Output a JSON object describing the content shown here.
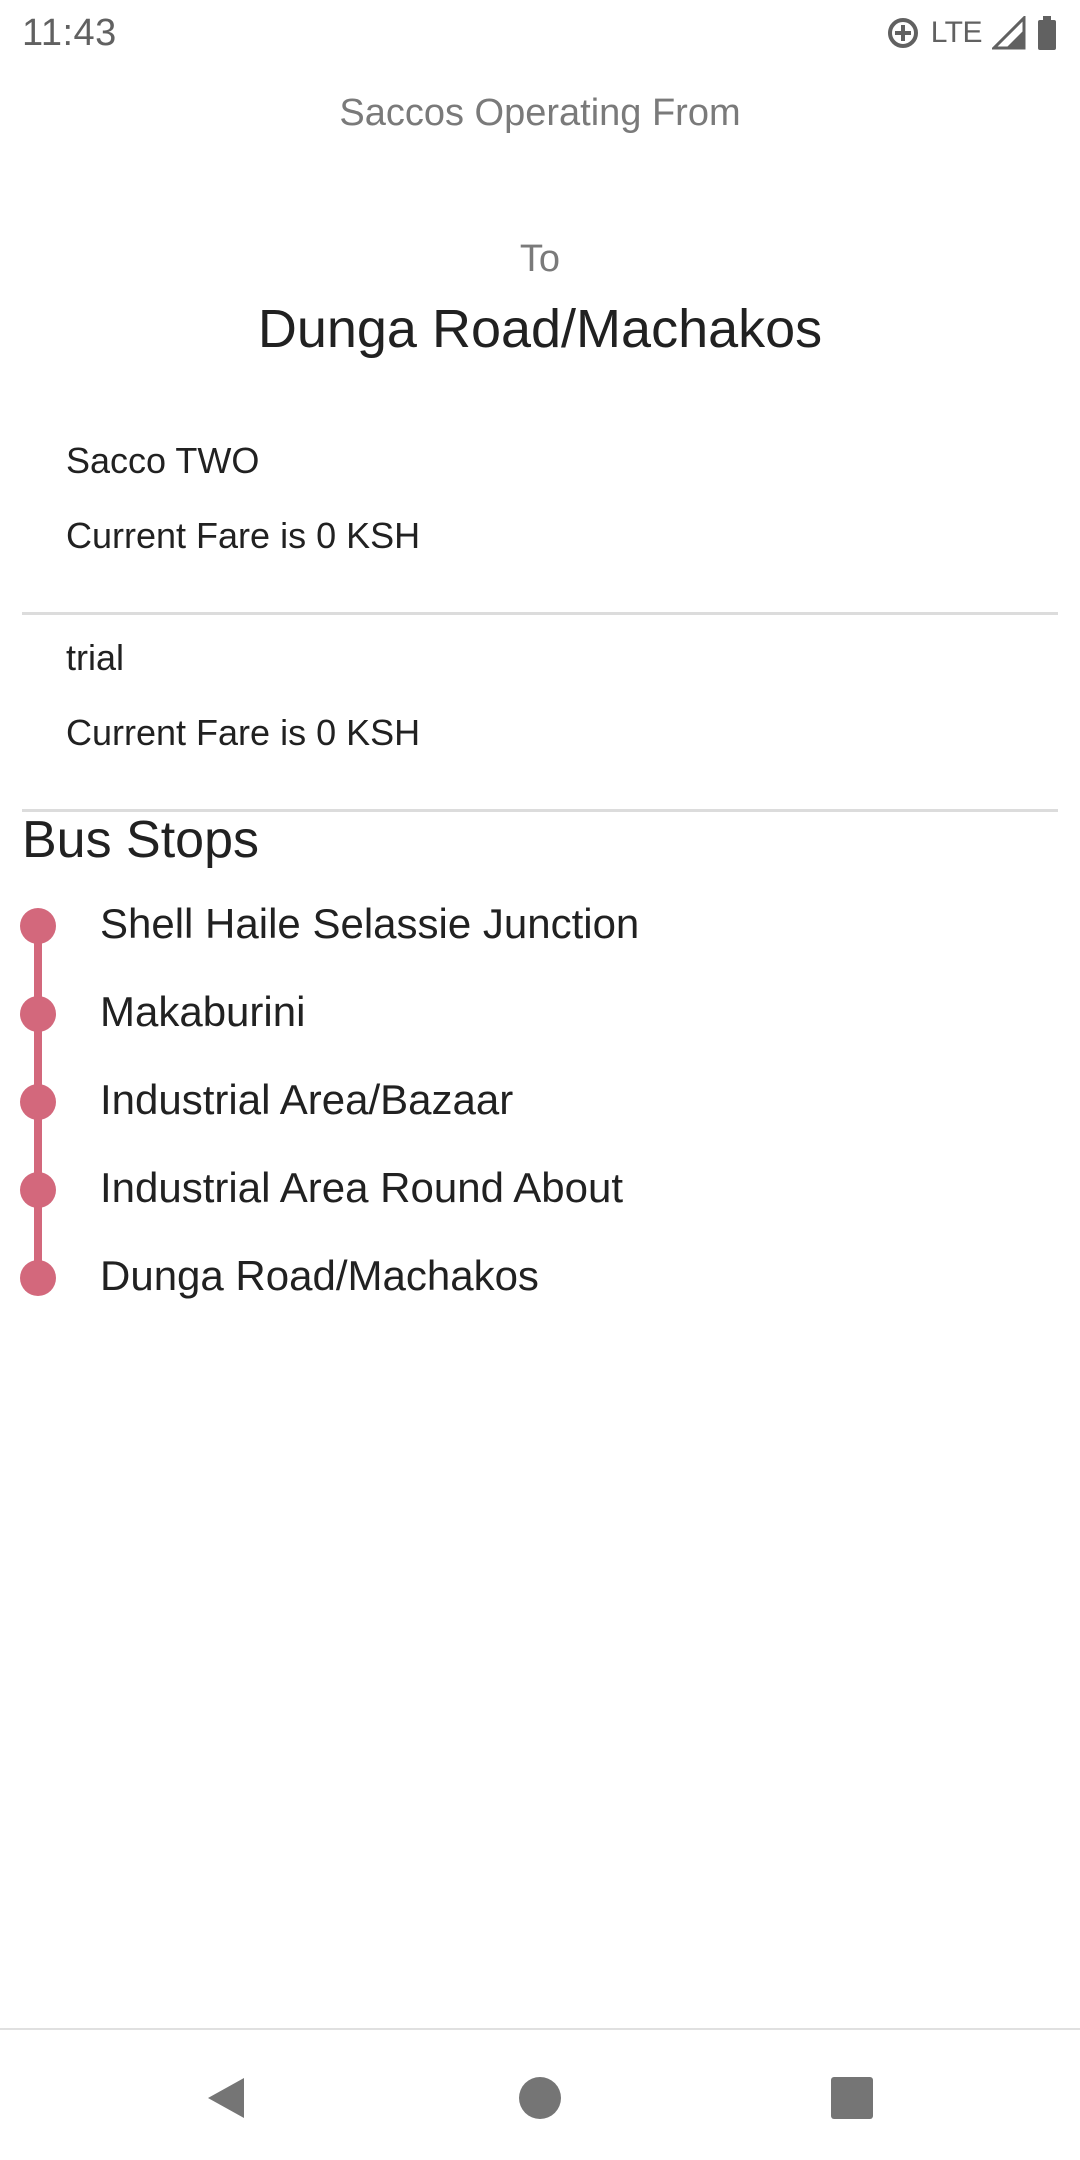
{
  "status_bar": {
    "time": "11:43",
    "network_label": "LTE",
    "icons": [
      "data-saver-icon",
      "signal-icon",
      "battery-icon"
    ]
  },
  "header": {
    "from_label": "Saccos Operating From",
    "to_label": "To",
    "destination": "Dunga Road/Machakos"
  },
  "saccos": [
    {
      "name": "Sacco TWO",
      "fare": "Current Fare is 0 KSH"
    },
    {
      "name": "trial",
      "fare": "Current Fare is 0 KSH"
    }
  ],
  "bus_stops": {
    "heading": "Bus Stops",
    "accent_color": "#d3687c",
    "stops": [
      "Shell Haile Selassie Junction",
      "Makaburini",
      "Industrial Area/Bazaar",
      "Industrial Area Round About",
      "Dunga Road/Machakos"
    ]
  },
  "nav_bar": {
    "icons": [
      "back-icon",
      "home-icon",
      "recents-icon"
    ]
  }
}
